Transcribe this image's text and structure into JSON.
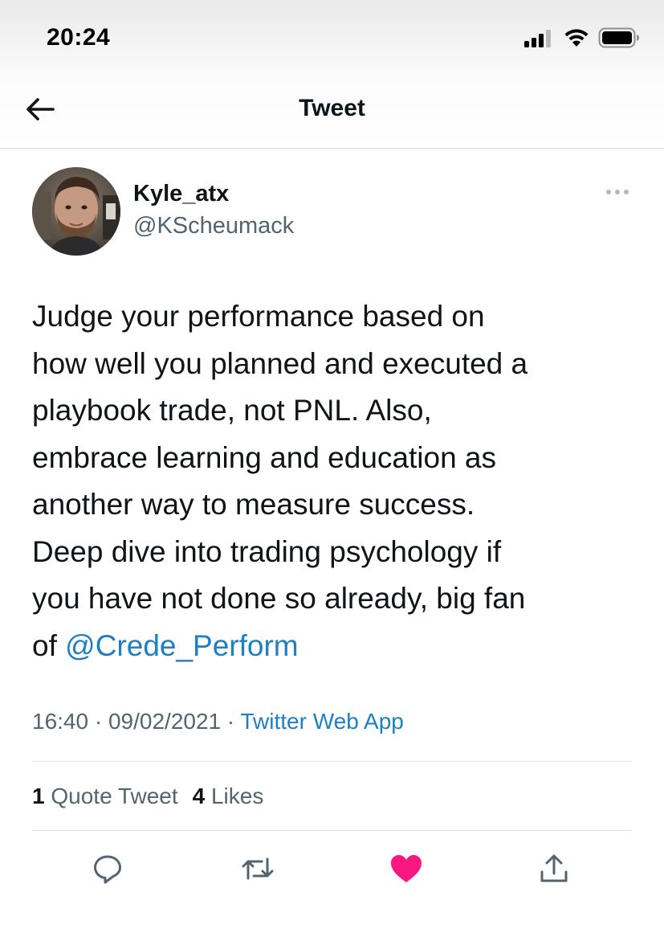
{
  "status_bar": {
    "time": "20:24",
    "icons": [
      "cellular-signal-icon",
      "wifi-icon",
      "battery-icon"
    ]
  },
  "nav": {
    "title": "Tweet",
    "back_icon": "back-arrow-icon"
  },
  "tweet": {
    "author": {
      "display_name": "Kyle_atx",
      "handle": "@KScheumack"
    },
    "text_lines": [
      "Judge your performance based on",
      "how well you planned and executed a",
      "playbook trade, not PNL.  Also,",
      "embrace learning and education as",
      "another way to measure success.",
      "Deep dive into trading psychology if",
      "you have not done so already, big fan"
    ],
    "last_line_prefix": "of ",
    "mention": "@Crede_Perform",
    "time": "16:40",
    "date": "09/02/2021",
    "separator": "·",
    "source": "Twitter Web App",
    "stats": {
      "quote_count": "1",
      "quote_label": "Quote Tweet",
      "like_count": "4",
      "like_label": "Likes"
    },
    "actions": [
      "reply-icon",
      "retweet-icon",
      "like-icon",
      "share-icon"
    ],
    "liked": true
  },
  "colors": {
    "text": "#0f1419",
    "secondary": "#536471",
    "link": "#1d7fc4",
    "like": "#f91880",
    "divider": "#e1e4e7"
  }
}
